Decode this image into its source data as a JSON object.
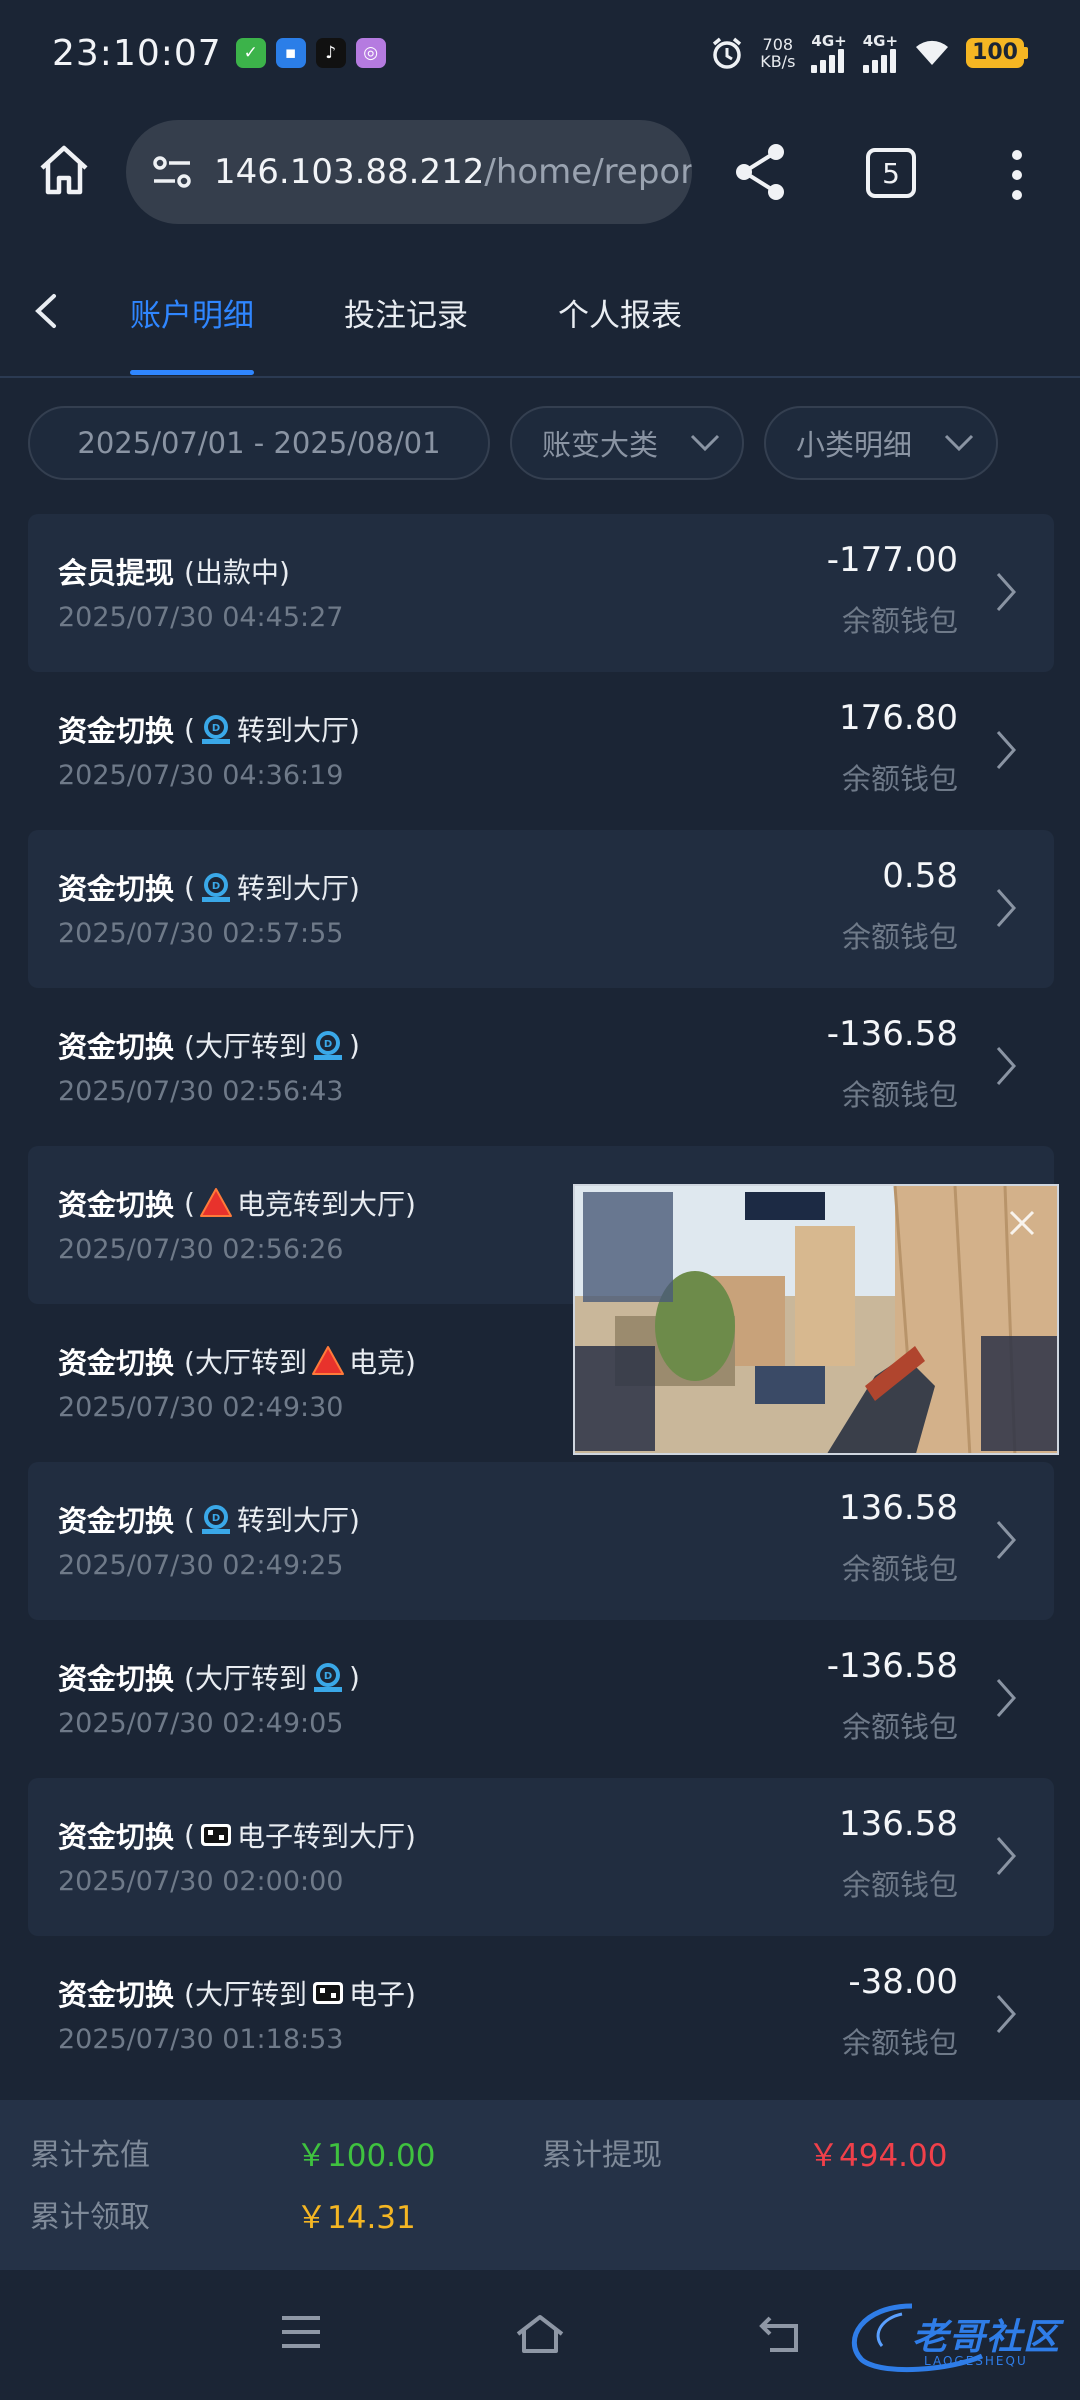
{
  "status_bar": {
    "time": "23:10:07",
    "net_speed_value": "708",
    "net_speed_unit": "KB/s",
    "signal1_label": "4G+",
    "signal2_label": "4G+",
    "battery": "100"
  },
  "browser": {
    "url_host": "146.103.88.212",
    "url_path": "/home/report?c",
    "tab_count": "5"
  },
  "tabs": [
    {
      "label": "账户明细",
      "active": true
    },
    {
      "label": "投注记录",
      "active": false
    },
    {
      "label": "个人报表",
      "active": false
    }
  ],
  "filters": {
    "date_range": "2025/07/01 - 2025/08/01",
    "category": "账变大类",
    "subcategory": "小类明细"
  },
  "records": [
    {
      "title": "会员提现",
      "detail_pre": "(出款中)",
      "icon": "",
      "detail_post": "",
      "time": "2025/07/30 04:45:27",
      "amount": "-177.00",
      "wallet": "余额钱包"
    },
    {
      "title": "资金切换",
      "detail_pre": "(",
      "icon": "esports-blue-icon",
      "detail_post": "转到大厅)",
      "time": "2025/07/30 04:36:19",
      "amount": "176.80",
      "wallet": "余额钱包"
    },
    {
      "title": "资金切换",
      "detail_pre": "(",
      "icon": "esports-blue-icon",
      "detail_post": "转到大厅)",
      "time": "2025/07/30 02:57:55",
      "amount": "0.58",
      "wallet": "余额钱包"
    },
    {
      "title": "资金切换",
      "detail_pre": "(大厅转到",
      "icon": "esports-blue-icon",
      "detail_post": ")",
      "time": "2025/07/30 02:56:43",
      "amount": "-136.58",
      "wallet": "余额钱包"
    },
    {
      "title": "资金切换",
      "detail_pre": "(",
      "icon": "red-triangle-icon",
      "detail_post": "电竞转到大厅)",
      "time": "2025/07/30 02:56:26",
      "amount": "",
      "wallet": ""
    },
    {
      "title": "资金切换",
      "detail_pre": "(大厅转到",
      "icon": "red-triangle-icon",
      "detail_post": "电竞)",
      "time": "2025/07/30 02:49:30",
      "amount": "",
      "wallet": ""
    },
    {
      "title": "资金切换",
      "detail_pre": "(",
      "icon": "esports-blue-icon",
      "detail_post": "转到大厅)",
      "time": "2025/07/30 02:49:25",
      "amount": "136.58",
      "wallet": "余额钱包"
    },
    {
      "title": "资金切换",
      "detail_pre": "(大厅转到",
      "icon": "esports-blue-icon",
      "detail_post": ")",
      "time": "2025/07/30 02:49:05",
      "amount": "-136.58",
      "wallet": "余额钱包"
    },
    {
      "title": "资金切换",
      "detail_pre": "(",
      "icon": "electronic-games-icon",
      "detail_post": "电子转到大厅)",
      "time": "2025/07/30 02:00:00",
      "amount": "136.58",
      "wallet": "余额钱包"
    },
    {
      "title": "资金切换",
      "detail_pre": "(大厅转到",
      "icon": "electronic-games-icon",
      "detail_post": "电子)",
      "time": "2025/07/30 01:18:53",
      "amount": "-38.00",
      "wallet": "余额钱包"
    }
  ],
  "totals": {
    "recharge_label": "累计充值",
    "recharge_value": "￥100.00",
    "withdraw_label": "累计提现",
    "withdraw_value": "￥494.00",
    "claim_label": "累计领取",
    "claim_value": "￥14.31"
  },
  "watermark": {
    "text": "老哥社区",
    "sub": "LAOGESHEQU"
  },
  "colors": {
    "background": "#1b2535",
    "accent": "#2f86ff",
    "positive": "#3fc23f",
    "negative": "#f0404a",
    "claim": "#f5b623"
  }
}
